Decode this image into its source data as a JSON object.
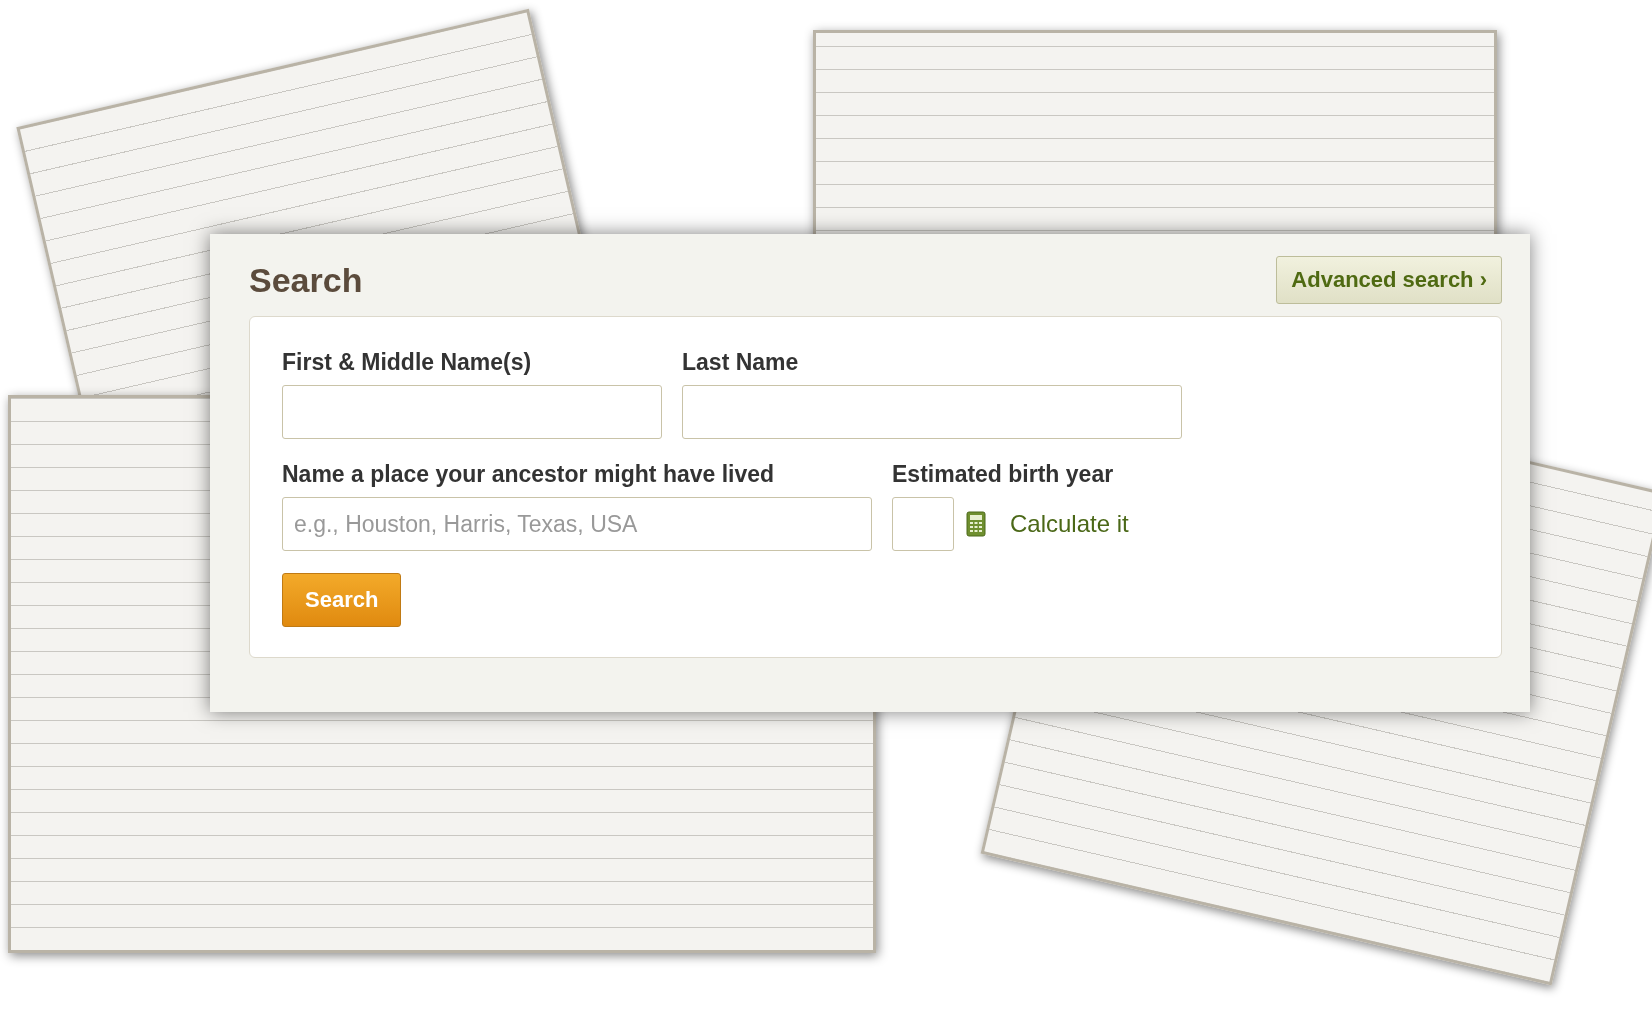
{
  "search_panel": {
    "title": "Search",
    "advanced_link": "Advanced search ›",
    "fields": [
      {
        "label": "First & Middle Name(s)"
      },
      {
        "label": "Last Name"
      }
    ],
    "place_field": {
      "label": "Name a place your ancestor might have lived",
      "placeholder": "e.g., Houston, Harris, Texas, USA"
    },
    "birth_year": {
      "label": "Estimated birth year",
      "calculate_link": "Calculate it"
    },
    "search_button": "Search"
  }
}
